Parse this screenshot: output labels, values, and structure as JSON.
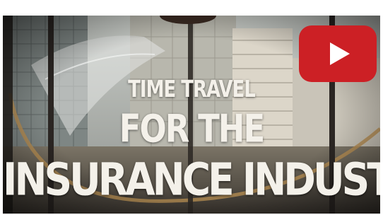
{
  "video": {
    "title_line1": "TIME TRAVEL",
    "title_line2": "FOR THE",
    "title_line3": "INSURANCE INDUSTRY",
    "play_icon": "youtube-play-icon",
    "play_color": "#cc2025"
  }
}
